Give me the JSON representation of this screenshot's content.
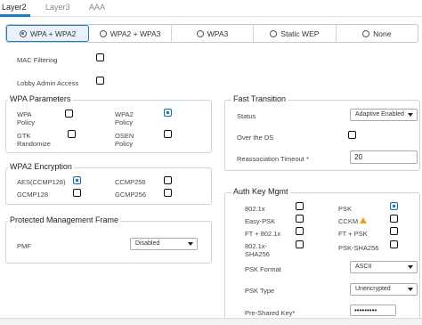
{
  "tabs": [
    "Layer2",
    "Layer3",
    "AAA"
  ],
  "security_options": [
    "WPA + WPA2",
    "WPA2 + WPA3",
    "WPA3",
    "Static WEP",
    "None"
  ],
  "top": {
    "mac_filtering": "MAC Filtering",
    "lobby_admin_access": "Lobby Admin Access"
  },
  "wpa_parameters": {
    "title": "WPA Parameters",
    "wpa_policy_1": "WPA",
    "wpa_policy_2": "Policy",
    "wpa2_policy_1": "WPA2",
    "wpa2_policy_2": "Policy",
    "gtk_1": "GTK",
    "gtk_2": "Randomize",
    "osen_1": "OSEN",
    "osen_2": "Policy"
  },
  "wpa2_encryption": {
    "title": "WPA2 Encryption",
    "aes": "AES(CCMP128)",
    "ccmp256": "CCMP256",
    "gcmp128": "GCMP128",
    "gcmp256": "GCMP256"
  },
  "pmf": {
    "title": "Protected Management Frame",
    "label": "PMF",
    "value": "Disabled"
  },
  "fast_transition": {
    "title": "Fast Transition",
    "status_label": "Status",
    "status_value": "Adaptive Enabled",
    "over_ds": "Over the DS",
    "timeout_label": "Reassociation Timeout *",
    "timeout_value": "20"
  },
  "akm": {
    "title": "Auth Key Mgmt",
    "dot1x": "802.1x",
    "psk": "PSK",
    "easy_psk": "Easy-PSK",
    "cckm": "CCKM",
    "ft_dot1x": "FT + 802.1x",
    "ft_psk": "FT + PSK",
    "dot1x_sha256_1": "802.1x-",
    "dot1x_sha256_2": "SHA256",
    "psk_sha256": "PSK-SHA256",
    "psk_format_label": "PSK Format",
    "psk_format_value": "ASCII",
    "psk_type_label": "PSK Type",
    "psk_type_value": "Unencrypted",
    "psk_key_label": "Pre-Shared Key*",
    "psk_key_value": "•••••••••"
  },
  "colors": {
    "accent": "#1a7fbf",
    "panel_border": "#c5d6e6",
    "warning": "#e8a317"
  }
}
